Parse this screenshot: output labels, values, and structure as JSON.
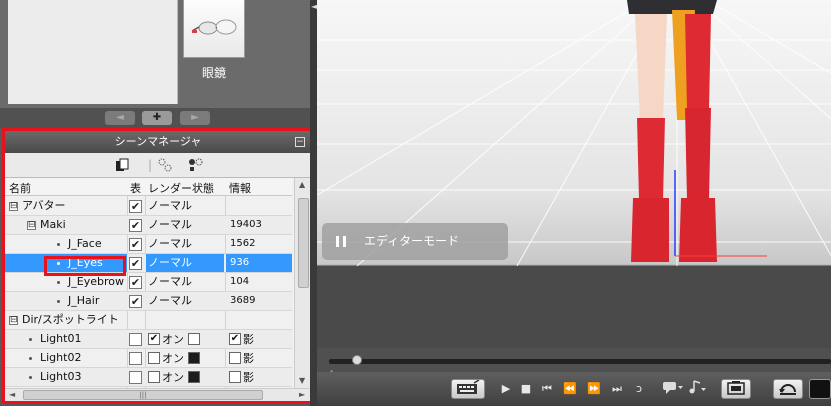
{
  "asset_panel": {
    "item_label": "眼鏡",
    "nav_prev": "◄",
    "nav_add": "✚",
    "nav_next": "►"
  },
  "scene_manager": {
    "title": "シーンマネージャ",
    "minimize": "−",
    "columns": {
      "name": "名前",
      "visible": "表",
      "render": "レンダー状態",
      "info": "情報"
    },
    "rows": [
      {
        "name": "アバター",
        "toggle": "⊟",
        "checked": true,
        "render": "ノーマル",
        "info": ""
      },
      {
        "name": "Maki",
        "toggle": "⊟",
        "checked": true,
        "render": "ノーマル",
        "info": "19403"
      },
      {
        "name": "J_Face",
        "checked": true,
        "render": "ノーマル",
        "info": "1562"
      },
      {
        "name": "J_Eyes",
        "checked": true,
        "render": "ノーマル",
        "info": "936"
      },
      {
        "name": "J_Eyebrow",
        "checked": true,
        "render": "ノーマル",
        "info": "104"
      },
      {
        "name": "J_Hair",
        "checked": true,
        "render": "ノーマル",
        "info": "3689"
      },
      {
        "name": "Dir/スポットライト",
        "toggle": "⊟"
      },
      {
        "name": "Light01",
        "on_label": "オン",
        "shadow_label": "影"
      },
      {
        "name": "Light02",
        "on_label": "オン",
        "shadow_label": "影"
      },
      {
        "name": "Light03",
        "on_label": "オン",
        "shadow_label": "影"
      }
    ]
  },
  "viewport": {
    "editor_mode_label": "エディターモード"
  },
  "transport": {
    "play": "▶",
    "stop": "■",
    "to_start": "⏮",
    "rewind": "⏪",
    "fast_forward": "⏩",
    "to_end": "⏭",
    "loop": "ↄ",
    "more": "▸"
  },
  "colors": {
    "highlight_red": "#e8121c",
    "selection_blue": "#3399ff"
  }
}
